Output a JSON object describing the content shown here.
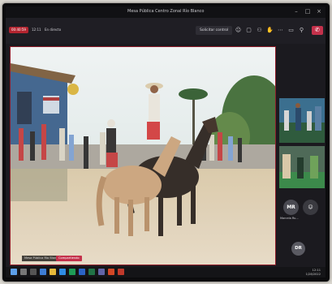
{
  "window": {
    "title": "Mesa Pública Centro Zonal Río Blanco"
  },
  "toolbar": {
    "rec_badge": "00:40:59",
    "rec_time": "12:11",
    "rec_status": "En directo",
    "ask_control_label": "Solicitar control",
    "icons": [
      "reactions-icon",
      "chat-icon",
      "participants-icon",
      "raise-hand-icon",
      "more-icon",
      "camera-icon",
      "mic-icon"
    ]
  },
  "stage": {
    "presenter_label": "Mesa Pública Río Blanco",
    "presenter_pill": "Compartiendo"
  },
  "rail": {
    "participant_mr": {
      "initials": "MR",
      "label": "Marcela Ru..."
    },
    "participant_dr": {
      "initials": "DR"
    }
  },
  "taskbar": {
    "time": "12:11",
    "date": "1/28/2022"
  },
  "colors": {
    "leave": "#c4314b",
    "recording": "#b3242f",
    "stage_border": "#8f1d2a"
  }
}
